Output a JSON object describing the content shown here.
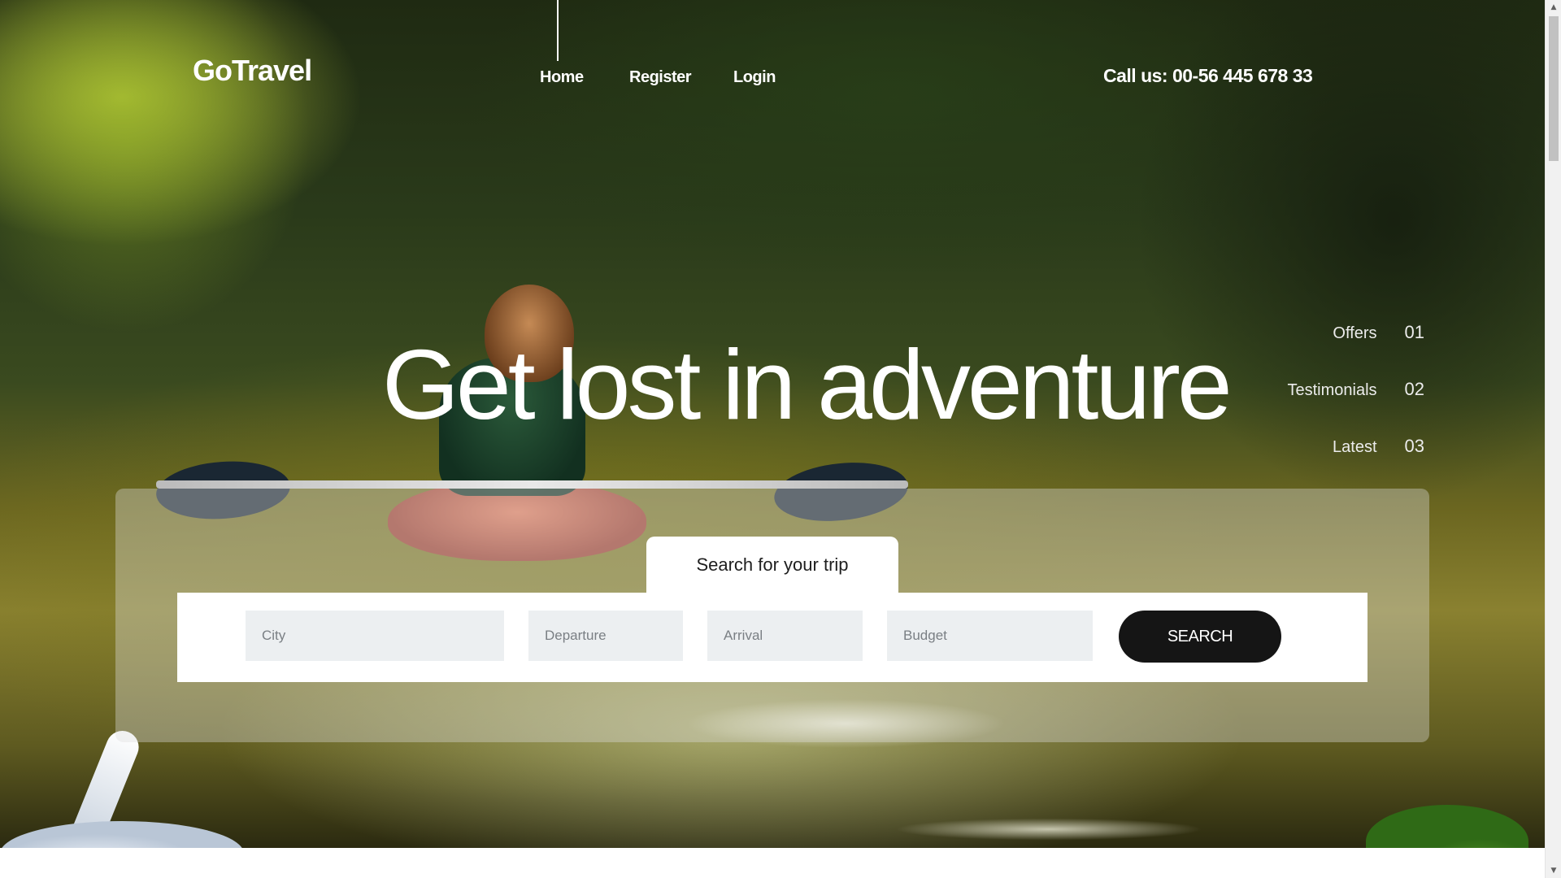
{
  "header": {
    "logo": "GoTravel",
    "nav": {
      "home": "Home",
      "register": "Register",
      "login": "Login"
    },
    "phone": "Call us: 00-56 445 678 33"
  },
  "hero": {
    "title": "Get lost in adventure"
  },
  "side_nav": [
    {
      "label": "Offers",
      "num": "01"
    },
    {
      "label": "Testimonials",
      "num": "02"
    },
    {
      "label": "Latest",
      "num": "03"
    }
  ],
  "search": {
    "tab_label": "Search for your trip",
    "city_placeholder": "City",
    "departure_placeholder": "Departure",
    "arrival_placeholder": "Arrival",
    "budget_placeholder": "Budget",
    "button_label": "SEARCH"
  },
  "scrollbar": {
    "up_icon": "chevron-up-icon",
    "down_icon": "chevron-down-icon"
  }
}
